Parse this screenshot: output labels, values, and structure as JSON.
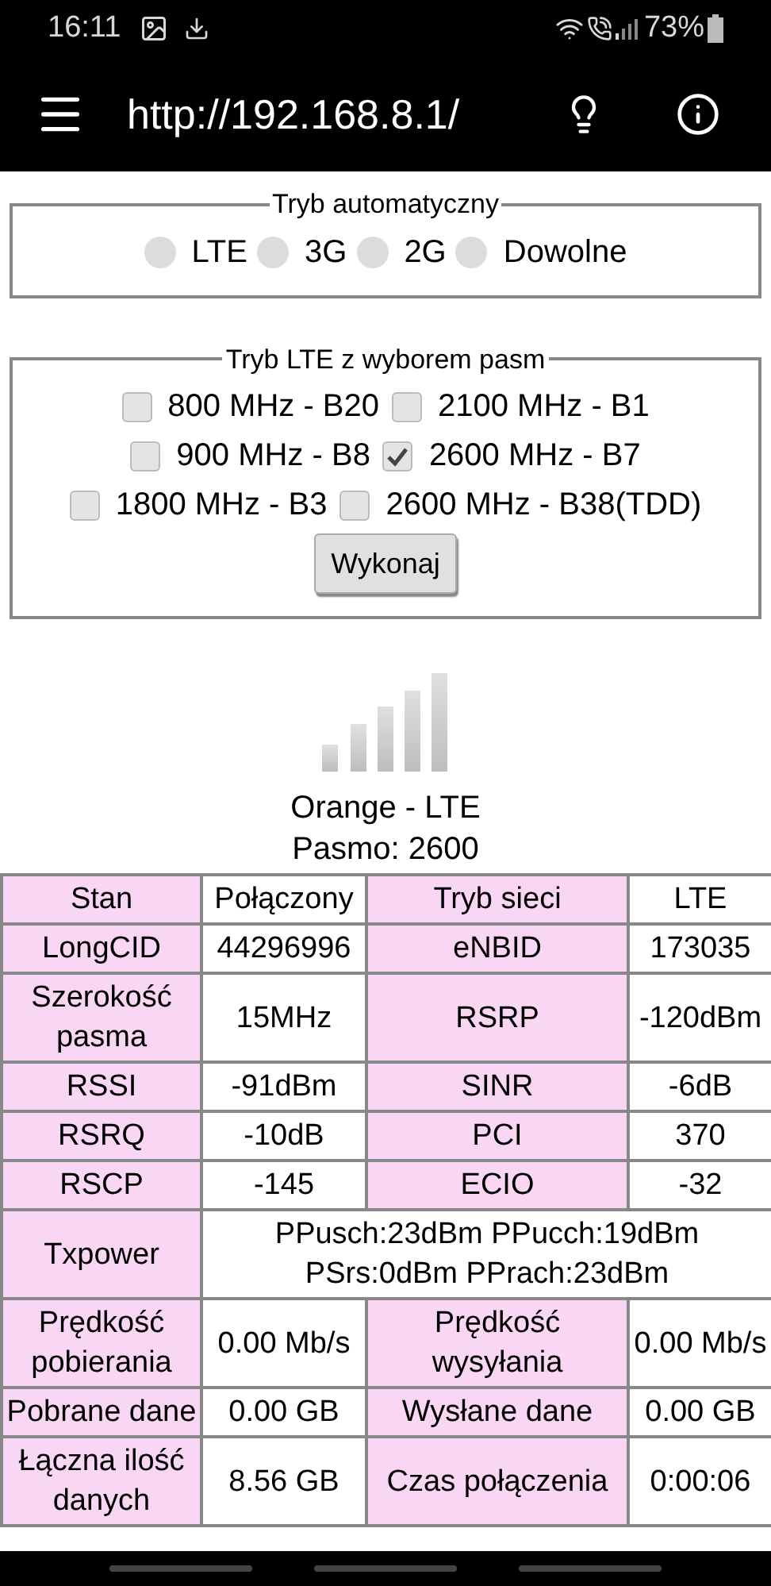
{
  "status_bar": {
    "time": "16:11",
    "battery": "73%"
  },
  "app_bar": {
    "title": "http://192.168.8.1/"
  },
  "auto_mode": {
    "legend": "Tryb automatyczny",
    "options": [
      {
        "label": "LTE",
        "selected": false
      },
      {
        "label": "3G",
        "selected": false
      },
      {
        "label": "2G",
        "selected": false
      },
      {
        "label": "Dowolne",
        "selected": false
      }
    ]
  },
  "band_mode": {
    "legend": "Tryb LTE z wyborem pasm",
    "rows": [
      [
        {
          "label": "800 MHz - B20",
          "checked": false
        },
        {
          "label": "2100 MHz - B1",
          "checked": false
        }
      ],
      [
        {
          "label": "900 MHz - B8",
          "checked": false
        },
        {
          "label": "2600 MHz - B7",
          "checked": true
        }
      ],
      [
        {
          "label": "1800 MHz - B3",
          "checked": false
        },
        {
          "label": "2600 MHz - B38(TDD)",
          "checked": false
        }
      ]
    ],
    "button": "Wykonaj"
  },
  "network": {
    "operator": "Orange - LTE",
    "band": "Pasmo: 2600"
  },
  "table": {
    "rows": [
      [
        {
          "kind": "label",
          "text": "Stan"
        },
        {
          "kind": "value",
          "text": "Połączony"
        },
        {
          "kind": "label",
          "text": "Tryb sieci"
        },
        {
          "kind": "value",
          "text": "LTE"
        }
      ],
      [
        {
          "kind": "label",
          "text": "LongCID"
        },
        {
          "kind": "value",
          "text": "44296996"
        },
        {
          "kind": "label",
          "text": "eNBID"
        },
        {
          "kind": "value",
          "text": "173035"
        }
      ],
      [
        {
          "kind": "label",
          "text": "Szerokość pasma"
        },
        {
          "kind": "value",
          "text": "15MHz"
        },
        {
          "kind": "label",
          "text": "RSRP"
        },
        {
          "kind": "value",
          "text": "-120dBm"
        }
      ],
      [
        {
          "kind": "label",
          "text": "RSSI"
        },
        {
          "kind": "value",
          "text": "-91dBm"
        },
        {
          "kind": "label",
          "text": "SINR"
        },
        {
          "kind": "value",
          "text": "-6dB"
        }
      ],
      [
        {
          "kind": "label",
          "text": "RSRQ"
        },
        {
          "kind": "value",
          "text": "-10dB"
        },
        {
          "kind": "label",
          "text": "PCI"
        },
        {
          "kind": "value",
          "text": "370"
        }
      ],
      [
        {
          "kind": "label",
          "text": "RSCP"
        },
        {
          "kind": "value",
          "text": "-145"
        },
        {
          "kind": "label",
          "text": "ECIO"
        },
        {
          "kind": "value",
          "text": "-32"
        }
      ],
      [
        {
          "kind": "label",
          "text": "Txpower"
        },
        {
          "kind": "wide",
          "colspan": 3,
          "text": "PPusch:23dBm PPucch:19dBm PSrs:0dBm PPrach:23dBm"
        }
      ],
      [
        {
          "kind": "label",
          "text": "Prędkość pobierania"
        },
        {
          "kind": "value",
          "text": "0.00 Mb/s"
        },
        {
          "kind": "label",
          "text": "Prędkość wysyłania"
        },
        {
          "kind": "value",
          "text": "0.00 Mb/s"
        }
      ],
      [
        {
          "kind": "label",
          "text": "Pobrane dane"
        },
        {
          "kind": "value",
          "text": "0.00 GB"
        },
        {
          "kind": "label",
          "text": "Wysłane dane"
        },
        {
          "kind": "value",
          "text": "0.00 GB"
        }
      ],
      [
        {
          "kind": "label",
          "text": "Łączna ilość danych"
        },
        {
          "kind": "value",
          "text": "8.56 GB"
        },
        {
          "kind": "label",
          "text": "Czas połączenia"
        },
        {
          "kind": "value",
          "text": "0:00:06"
        }
      ]
    ]
  }
}
